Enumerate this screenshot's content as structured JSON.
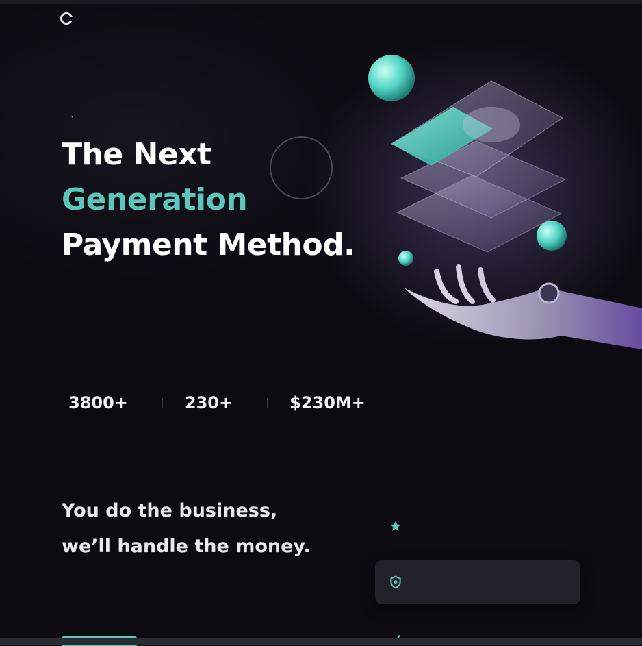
{
  "nav": {
    "logo_text": "",
    "items": [
      {
        "label": "",
        "active": true
      },
      {
        "label": "",
        "active": false
      },
      {
        "label": "",
        "active": false
      },
      {
        "label": "",
        "active": false
      }
    ]
  },
  "hero": {
    "eyebrow": "",
    "title_line1": "The Next",
    "title_line2": "Generation",
    "title_line3": "Payment Method.",
    "badge": "",
    "description": ""
  },
  "stats": [
    {
      "value": "3800+",
      "label": ""
    },
    {
      "value": "230+",
      "label": ""
    },
    {
      "value": "$230M+",
      "label": ""
    }
  ],
  "section2": {
    "title_line1": "You do the business,",
    "title_line2": "we’ll handle the money.",
    "description": "",
    "cta_label": ""
  },
  "features": [
    {
      "title": "",
      "text": "",
      "icon": "star-icon"
    },
    {
      "title": "",
      "text": "",
      "icon": "shield-icon"
    },
    {
      "title": "",
      "text": "",
      "icon": "transfer-icon"
    }
  ],
  "colors": {
    "background": "#0c0b12",
    "accent": "#5cc6bb",
    "text": "#ffffff",
    "muted": "#6f6e79"
  }
}
